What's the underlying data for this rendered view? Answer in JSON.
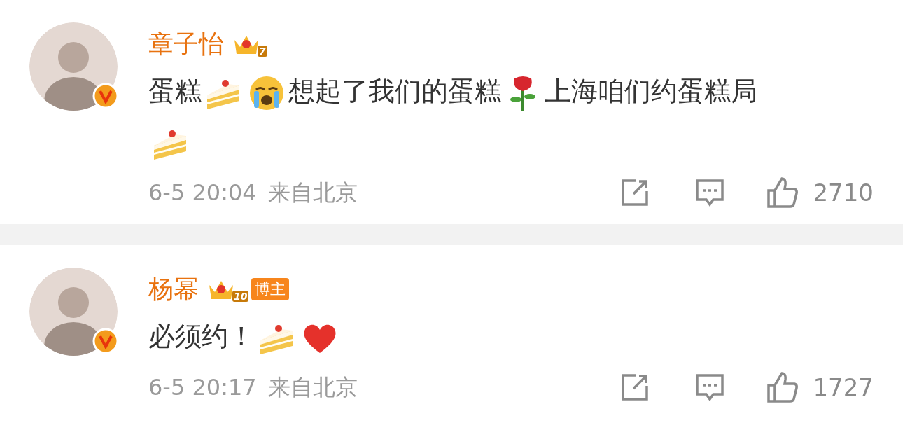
{
  "comments": [
    {
      "author": "章子怡",
      "crown_level": "7",
      "verified": true,
      "content": [
        {
          "kind": "text",
          "text": "蛋糕"
        },
        {
          "kind": "cake"
        },
        {
          "kind": "crying"
        },
        {
          "kind": "text",
          "text": "想起了我们的蛋糕"
        },
        {
          "kind": "rose"
        },
        {
          "kind": "text",
          "text": "上海咱们约蛋糕局"
        },
        {
          "kind": "cake"
        }
      ],
      "time": "6-5 20:04",
      "location": "来自北京",
      "likes": "2710"
    },
    {
      "author": "杨幂",
      "crown_level": "10",
      "badge": "博主",
      "verified": true,
      "content": [
        {
          "kind": "text",
          "text": "必须约！"
        },
        {
          "kind": "cake"
        },
        {
          "kind": "heart"
        }
      ],
      "time": "6-5 20:17",
      "location": "来自北京",
      "likes": "1727"
    }
  ]
}
